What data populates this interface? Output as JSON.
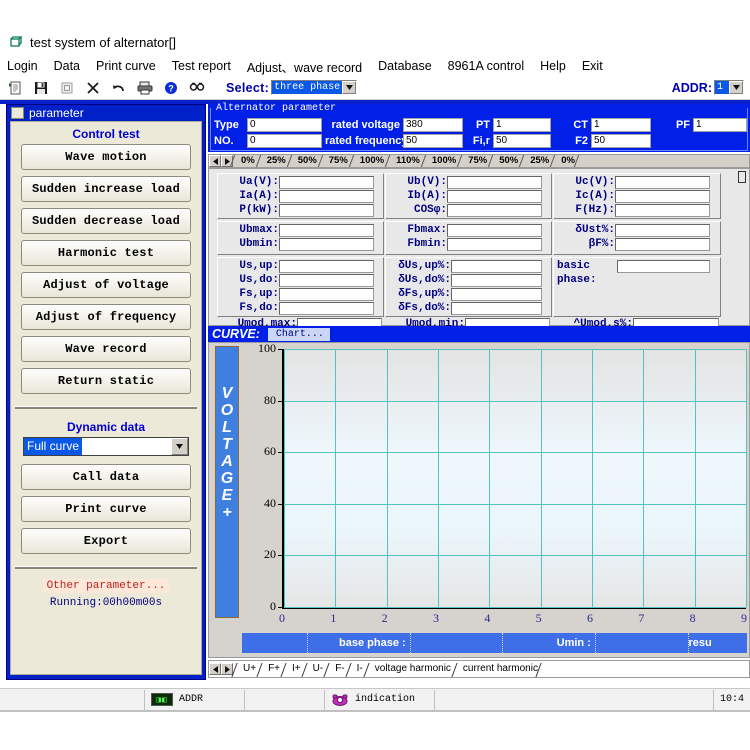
{
  "window": {
    "title": "test system of alternator[]",
    "title_icon": "window-restore-icon"
  },
  "menubar": {
    "items": [
      {
        "label": "Login"
      },
      {
        "label": "Data"
      },
      {
        "label": "Print curve"
      },
      {
        "label": "Test report"
      },
      {
        "label": "Adjust、wave record"
      },
      {
        "label": "Database"
      },
      {
        "label": "8961A control"
      },
      {
        "label": "Help"
      },
      {
        "label": "Exit"
      }
    ]
  },
  "toolbar": {
    "icons": [
      {
        "name": "new-document-icon"
      },
      {
        "name": "save-icon"
      },
      {
        "name": "form-icon"
      },
      {
        "name": "delete-icon"
      },
      {
        "name": "undo-icon"
      },
      {
        "name": "print-icon"
      },
      {
        "name": "help-icon"
      },
      {
        "name": "find-icon"
      }
    ],
    "select_label": "Select:",
    "select_value": "three phase",
    "addr_label": "ADDR:",
    "addr_value": "1"
  },
  "left_panel": {
    "title": "parameter",
    "control_test_heading": "Control test",
    "buttons": [
      {
        "label": "Wave motion"
      },
      {
        "label": "Sudden increase load"
      },
      {
        "label": "Sudden decrease load"
      },
      {
        "label": "Harmonic test"
      },
      {
        "label": "Adjust of voltage"
      },
      {
        "label": "Adjust of frequency"
      },
      {
        "label": "Wave record"
      },
      {
        "label": "Return static"
      }
    ],
    "dynamic_heading": "Dynamic data",
    "dropdown_value": "Full curve",
    "dynamic_buttons": [
      {
        "label": "Call data"
      },
      {
        "label": "Print curve"
      },
      {
        "label": "Export"
      }
    ],
    "other_parameter": "Other parameter...",
    "running": "Running:00h00m00s"
  },
  "alternator_parameter": {
    "legend": "Alternator parameter",
    "fields": [
      {
        "label": "Type",
        "value": "0"
      },
      {
        "label": "NO.",
        "value": "0"
      },
      {
        "label": "rated voltage",
        "value": "380"
      },
      {
        "label": "rated frequency",
        "value": "50"
      },
      {
        "label": "PT",
        "value": "1"
      },
      {
        "label": "Fi,r",
        "value": "50"
      },
      {
        "label": "CT",
        "value": "1"
      },
      {
        "label": "F2",
        "value": "50"
      },
      {
        "label": "PF",
        "value": "1"
      }
    ]
  },
  "percent_tabs": {
    "items": [
      "0%",
      "25%",
      "50%",
      "75%",
      "100%",
      "110%",
      "100%",
      "75%",
      "50%",
      "25%",
      "0%"
    ],
    "nav_left": "◀",
    "nav_right": "▶"
  },
  "measurements": {
    "group1": [
      {
        "label": "Ua(V):",
        "value": ""
      },
      {
        "label": "Ia(A):",
        "value": ""
      },
      {
        "label": "P(kW):",
        "value": ""
      },
      {
        "label": "Ub(V):",
        "value": ""
      },
      {
        "label": "Ib(A):",
        "value": ""
      },
      {
        "label": "COSφ:",
        "value": ""
      },
      {
        "label": "Uc(V):",
        "value": ""
      },
      {
        "label": "Ic(A):",
        "value": ""
      },
      {
        "label": "F(Hz):",
        "value": ""
      }
    ],
    "group2": [
      {
        "label": "Ubmax:",
        "value": ""
      },
      {
        "label": "Ubmin:",
        "value": ""
      },
      {
        "label": "Fbmax:",
        "value": ""
      },
      {
        "label": "Fbmin:",
        "value": ""
      },
      {
        "label": "δUst%:",
        "value": ""
      },
      {
        "label": "βF%:",
        "value": ""
      }
    ],
    "group3": [
      {
        "label": "Us,up:",
        "value": ""
      },
      {
        "label": "Us,do:",
        "value": ""
      },
      {
        "label": "Fs,up:",
        "value": ""
      },
      {
        "label": "Fs,do:",
        "value": ""
      },
      {
        "label": "δUs,up%:",
        "value": ""
      },
      {
        "label": "δUs,do%:",
        "value": ""
      },
      {
        "label": "δFs,up%:",
        "value": ""
      },
      {
        "label": "δFs,do%:",
        "value": ""
      }
    ],
    "group4": [
      {
        "label": "basic",
        "value": ""
      },
      {
        "label": "phase:",
        "value": ""
      }
    ],
    "group5": [
      {
        "label": "Umod,max:",
        "value": ""
      },
      {
        "label": "Umod,min:",
        "value": ""
      },
      {
        "label": "^Umod,s%:",
        "value": ""
      }
    ]
  },
  "curve": {
    "header_label": "CURVE:",
    "chart_label": "Chart..."
  },
  "chart_data": {
    "type": "line",
    "title": "",
    "xlabel": "",
    "ylabel": "VOLTAGE+",
    "ylim": [
      0,
      100
    ],
    "yticks": [
      0,
      20,
      40,
      60,
      80,
      100
    ],
    "xlim": [
      0,
      9
    ],
    "xticks": [
      0,
      1,
      2,
      3,
      4,
      5,
      6,
      7,
      8,
      9
    ],
    "grid": true,
    "series": [],
    "legend": "none",
    "note": "empty plot - no data traces drawn"
  },
  "chart_status_strip": {
    "cells": [
      "",
      "base phase :",
      "",
      "Umin :",
      "",
      "resu"
    ]
  },
  "bottom_tabs": {
    "nav_left": "◀",
    "nav_right": "▶",
    "items": [
      "U+",
      "F+",
      "I+",
      "U-",
      "F-",
      "I-",
      "voltage harmonic",
      "current harmonic"
    ]
  },
  "statusbar": {
    "addr_icon": "led-display-icon",
    "addr_label": "ADDR",
    "indication_icon": "phone-icon",
    "indication_label": "indication",
    "time": "10:4"
  }
}
